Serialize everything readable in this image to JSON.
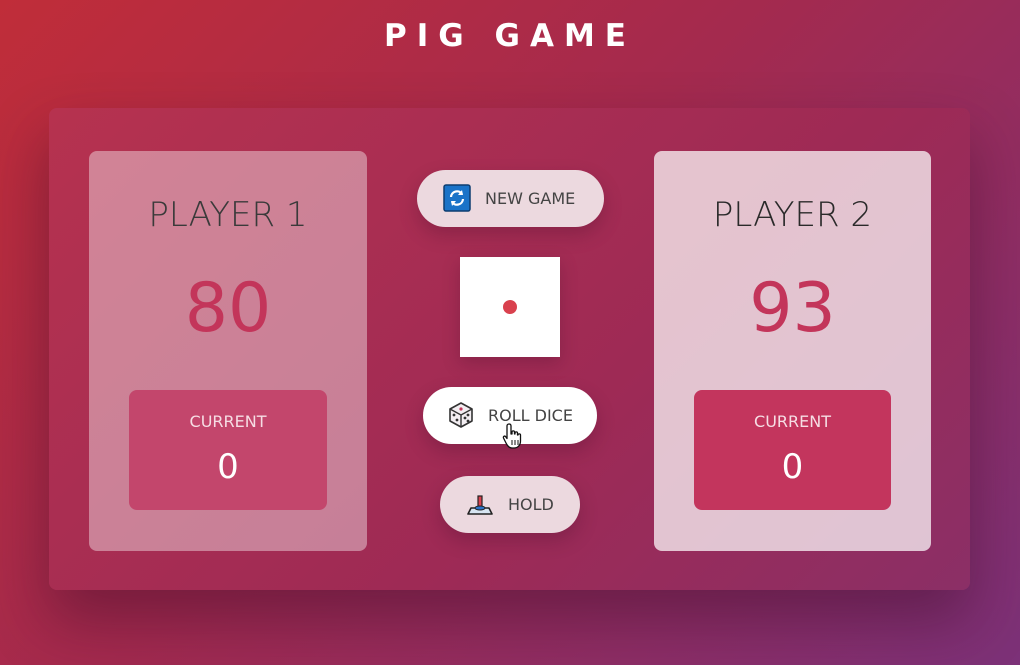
{
  "title": "PIG GAME",
  "players": [
    {
      "name": "PLAYER 1",
      "score": "80",
      "current_label": "CURRENT",
      "current": "0",
      "active": false
    },
    {
      "name": "PLAYER 2",
      "score": "93",
      "current_label": "CURRENT",
      "current": "0",
      "active": true
    }
  ],
  "buttons": {
    "new_game": "NEW GAME",
    "roll_dice": "ROLL DICE",
    "hold": "HOLD"
  },
  "dice": {
    "value": 1
  },
  "icons": {
    "new_game": "refresh-icon",
    "roll_dice": "dice-icon",
    "hold": "hold-icon"
  },
  "colors": {
    "score": "#c3355a",
    "pip": "#d9414e",
    "current_box": "#c3355d"
  }
}
